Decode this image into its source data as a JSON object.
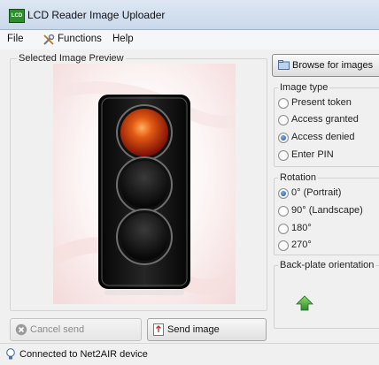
{
  "window": {
    "title": "LCD Reader Image Uploader",
    "icon_text": "LCD"
  },
  "menubar": {
    "items": [
      "File",
      "Functions",
      "Help"
    ]
  },
  "preview": {
    "legend": "Selected Image Preview"
  },
  "browse": {
    "label": "Browse for images"
  },
  "image_type": {
    "legend": "Image type",
    "options": [
      "Present token",
      "Access granted",
      "Access denied",
      "Enter PIN"
    ],
    "selected": "Access denied"
  },
  "rotation": {
    "legend": "Rotation",
    "options": [
      "0° (Portrait)",
      "90° (Landscape)",
      "180°",
      "270°"
    ],
    "selected": "0° (Portrait)"
  },
  "backplate": {
    "legend": "Back-plate orientation",
    "arrow_color": "#3fa33f"
  },
  "buttons": {
    "cancel_send": "Cancel send",
    "send_image": "Send image"
  },
  "status": {
    "text": "Connected to Net2AIR device"
  }
}
